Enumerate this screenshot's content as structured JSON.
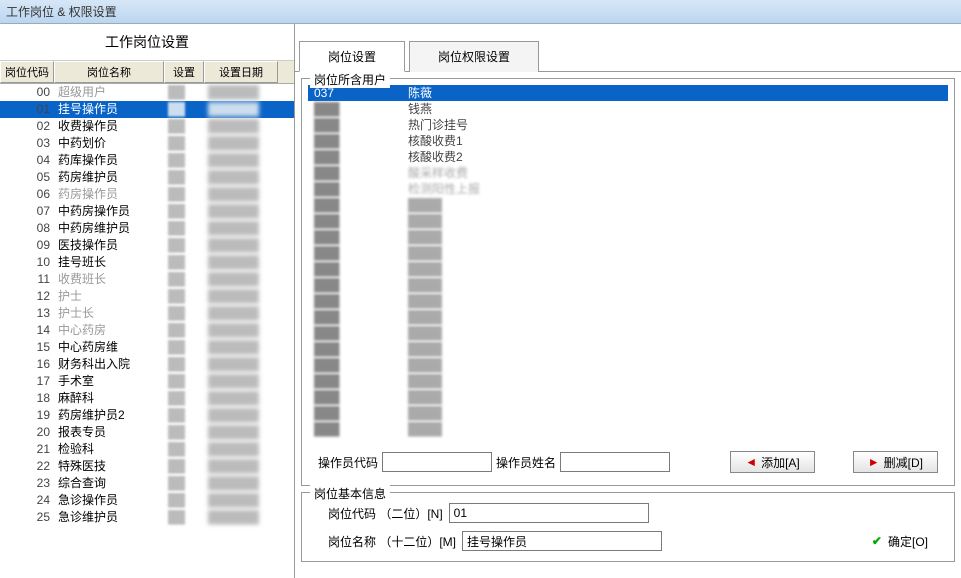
{
  "window": {
    "title": "工作岗位 & 权限设置"
  },
  "left": {
    "header": "工作岗位设置",
    "columns": {
      "code": "岗位代码",
      "name": "岗位名称",
      "set": "设置",
      "date": "设置日期"
    },
    "rows": [
      {
        "code": "00",
        "name": "超级用户",
        "gray": true
      },
      {
        "code": "01",
        "name": "挂号操作员",
        "selected": true
      },
      {
        "code": "02",
        "name": "收费操作员"
      },
      {
        "code": "03",
        "name": "中药划价"
      },
      {
        "code": "04",
        "name": "药库操作员"
      },
      {
        "code": "05",
        "name": "药房维护员"
      },
      {
        "code": "06",
        "name": "药房操作员",
        "gray": true
      },
      {
        "code": "07",
        "name": "中药房操作员"
      },
      {
        "code": "08",
        "name": "中药房维护员"
      },
      {
        "code": "09",
        "name": "医技操作员"
      },
      {
        "code": "10",
        "name": "挂号班长"
      },
      {
        "code": "11",
        "name": "收费班长",
        "gray": true
      },
      {
        "code": "12",
        "name": "护士",
        "gray": true
      },
      {
        "code": "13",
        "name": "护士长",
        "gray": true
      },
      {
        "code": "14",
        "name": "中心药房",
        "gray": true
      },
      {
        "code": "15",
        "name": "中心药房维"
      },
      {
        "code": "16",
        "name": "财务科出入院"
      },
      {
        "code": "17",
        "name": "手术室"
      },
      {
        "code": "18",
        "name": "麻醉科"
      },
      {
        "code": "19",
        "name": "药房维护员2"
      },
      {
        "code": "20",
        "name": "报表专员"
      },
      {
        "code": "21",
        "name": "检验科"
      },
      {
        "code": "22",
        "name": "特殊医技"
      },
      {
        "code": "23",
        "name": "综合查询"
      },
      {
        "code": "24",
        "name": "急诊操作员"
      },
      {
        "code": "25",
        "name": "急诊维护员"
      }
    ]
  },
  "right": {
    "tabs": {
      "t1": "岗位设置",
      "t2": "岗位权限设置"
    },
    "userbox_title": "岗位所含用户",
    "users": [
      {
        "code": "037",
        "name": "陈薇",
        "selected": true
      },
      {
        "code": "",
        "name": "钱燕"
      },
      {
        "code": "",
        "name": "热门诊挂号"
      },
      {
        "code": "",
        "name": "核酸收费1"
      },
      {
        "code": "",
        "name": "核酸收费2"
      },
      {
        "code": "",
        "name": "酸采样收费",
        "blur": true
      },
      {
        "code": "",
        "name": "检测阳性上报",
        "blur": true
      },
      {
        "code": "",
        "name": "",
        "blur": true
      },
      {
        "code": "",
        "name": "",
        "blur": true
      },
      {
        "code": "",
        "name": "",
        "blur": true
      },
      {
        "code": "",
        "name": "",
        "blur": true
      },
      {
        "code": "",
        "name": "",
        "blur": true
      },
      {
        "code": "",
        "name": "",
        "blur": true
      },
      {
        "code": "",
        "name": "",
        "blur": true
      },
      {
        "code": "",
        "name": "",
        "blur": true
      },
      {
        "code": "",
        "name": "",
        "blur": true
      },
      {
        "code": "",
        "name": "",
        "blur": true
      },
      {
        "code": "",
        "name": "",
        "blur": true
      },
      {
        "code": "",
        "name": "",
        "blur": true
      },
      {
        "code": "",
        "name": "",
        "blur": true
      },
      {
        "code": "",
        "name": "",
        "blur": true
      },
      {
        "code": "",
        "name": "",
        "blur": true
      }
    ],
    "op": {
      "code_label": "操作员代码",
      "name_label": "操作员姓名",
      "add": "添加[A]",
      "del": "删减[D]"
    },
    "infobox_title": "岗位基本信息",
    "info": {
      "code_label": "岗位代码 （二位）[N]",
      "code_value": "01",
      "name_label": "岗位名称 （十二位）[M]",
      "name_value": "挂号操作员",
      "ok": "确定[O]"
    }
  }
}
